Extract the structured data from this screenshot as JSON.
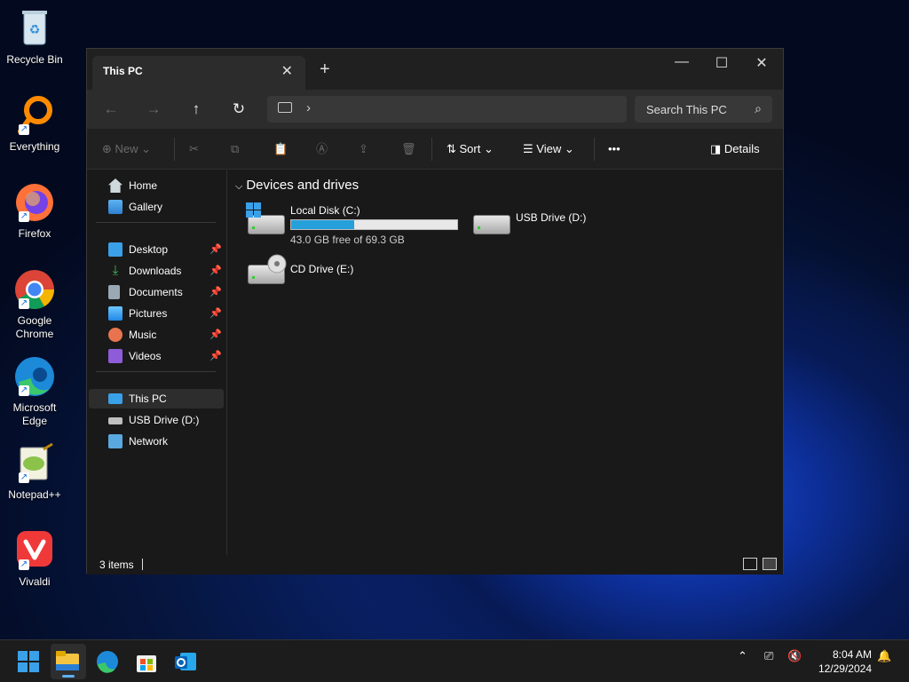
{
  "desktop": {
    "icons": [
      {
        "label": "Recycle Bin"
      },
      {
        "label": "Everything"
      },
      {
        "label": "Firefox"
      },
      {
        "label": "Google Chrome"
      },
      {
        "label": "Microsoft Edge"
      },
      {
        "label": "Notepad++"
      },
      {
        "label": "Vivaldi"
      }
    ]
  },
  "window": {
    "tab_title": "This PC",
    "close_tab": "✕",
    "new_tab": "+",
    "controls": {
      "minimize": "—",
      "maximize": "☐",
      "close": "✕"
    },
    "search_placeholder": "Search This PC",
    "toolbar": {
      "new": "New",
      "sort": "Sort",
      "view": "View",
      "more": "•••",
      "details": "Details"
    },
    "sidebar": {
      "items": [
        {
          "label": "Home",
          "icon": "home-icon",
          "pinned": false
        },
        {
          "label": "Gallery",
          "icon": "gallery-icon",
          "pinned": false
        },
        {
          "label": "Desktop",
          "icon": "desktop-icon",
          "pinned": true
        },
        {
          "label": "Downloads",
          "icon": "downloads-icon",
          "pinned": true
        },
        {
          "label": "Documents",
          "icon": "documents-icon",
          "pinned": true
        },
        {
          "label": "Pictures",
          "icon": "pictures-icon",
          "pinned": true
        },
        {
          "label": "Music",
          "icon": "music-icon",
          "pinned": true
        },
        {
          "label": "Videos",
          "icon": "videos-icon",
          "pinned": true
        },
        {
          "label": "This PC",
          "icon": "this-pc-icon",
          "pinned": false,
          "selected": true
        },
        {
          "label": "USB Drive (D:)",
          "icon": "usb-drive-icon",
          "pinned": false
        },
        {
          "label": "Network",
          "icon": "network-icon",
          "pinned": false
        }
      ]
    },
    "content": {
      "group_header": "Devices and drives",
      "drives": [
        {
          "name": "Local Disk (C:)",
          "free_text": "43.0 GB free of 69.3 GB",
          "used_fraction": 0.38
        },
        {
          "name": "USB Drive (D:)"
        },
        {
          "name": "CD Drive (E:)"
        }
      ]
    },
    "status": {
      "item_count": "3 items"
    }
  },
  "taskbar": {
    "clock_time": "8:04 AM",
    "clock_date": "12/29/2024"
  },
  "colors": {
    "accent": "#26a0da",
    "window_bg": "#191919",
    "toolbar_bg": "#202020"
  }
}
